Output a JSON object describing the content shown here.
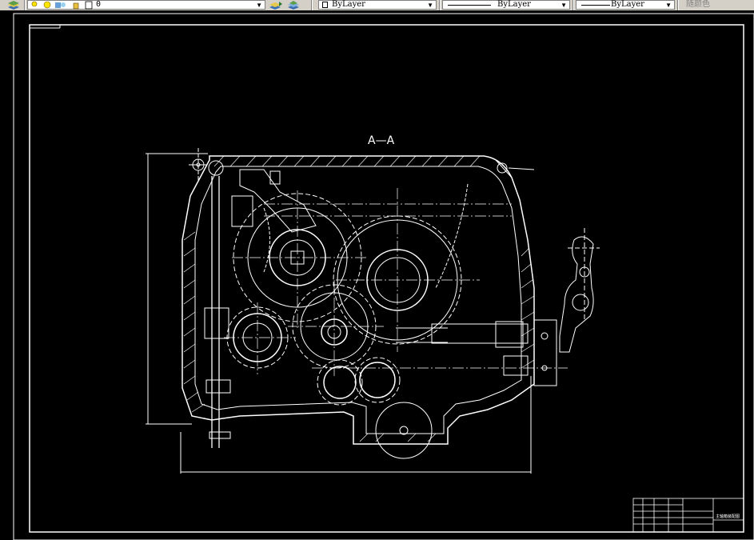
{
  "toolbar": {
    "layer_name": "0",
    "color": "ByLayer",
    "linetype": "ByLayer",
    "lineweight": "ByLayer",
    "plotstyle": "随颜色"
  },
  "drawing": {
    "section_label": "A—A",
    "title_block_text": "主轴箱装配图"
  },
  "colors": {
    "background": "#000000",
    "line": "#ffffff",
    "toolbar": "#d4d0c8"
  }
}
